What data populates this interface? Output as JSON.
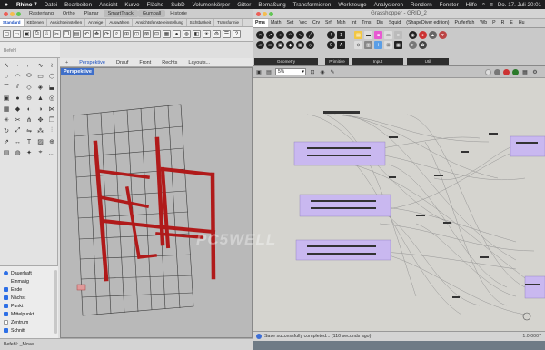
{
  "menubar": {
    "app": "Rhino 7",
    "items": [
      "Datei",
      "Bearbeiten",
      "Ansicht",
      "Kurve",
      "Fläche",
      "SubD",
      "Volumenkörper",
      "Gitter",
      "Bemaßung",
      "Transformieren",
      "Werkzeuge",
      "Analysieren",
      "Rendern",
      "Fenster",
      "Hilfe"
    ],
    "clock": "Do. 17. Juli 20:01"
  },
  "rhino": {
    "top_tabs": [
      "Rasterfang",
      "Ortho",
      "Planar",
      "SmartTrack",
      "Gumball",
      "Historie"
    ],
    "toolbar_tabs": [
      "Standard",
      "KEbenen",
      "Ansicht einstellen",
      "Anzeige",
      "Auswählen",
      "Ansichtsfenstereinstellung",
      "Sichtbarkeit",
      "Transformie"
    ],
    "command_placeholder": "Befehl",
    "viewport_tabs": [
      "Perspektive",
      "Drauf",
      "Front",
      "Rechts",
      "Layouts..."
    ],
    "viewport_label": "Perspektive",
    "osnap": [
      {
        "label": "Dauerhaft",
        "checked": true,
        "type": "radio"
      },
      {
        "label": "Einmalig",
        "checked": false,
        "type": "radio-hidden"
      },
      {
        "label": "Ende",
        "checked": true,
        "type": "check"
      },
      {
        "label": "Nächst",
        "checked": true,
        "type": "check"
      },
      {
        "label": "Punkt",
        "checked": true,
        "type": "check"
      },
      {
        "label": "Mittelpunkt",
        "checked": true,
        "type": "check"
      },
      {
        "label": "Zentrum",
        "checked": false,
        "type": "check"
      },
      {
        "label": "Schnitt",
        "checked": true,
        "type": "check"
      }
    ],
    "status": "Befehl: _Move"
  },
  "grasshopper": {
    "title": "Grasshopper - GRID_2",
    "tabs": [
      "Pms",
      "Math",
      "Set",
      "Vec",
      "Crv",
      "Srf",
      "Msh",
      "Int",
      "Trns",
      "Dis",
      "Squid",
      "(ShapeDiver edition)",
      "Pufferfish",
      "Wb",
      "P",
      "R",
      "E",
      "Hu"
    ],
    "groups": [
      "Geometry",
      "Primitive",
      "Input",
      "Util"
    ],
    "zoom": "5%",
    "status_message": "Save successfully completed... (110 seconds ago)",
    "version": "1.0.0007"
  },
  "colors": {
    "chair_red": "#b01a1a",
    "node_purple": "#c9b8f0",
    "accent_blue": "#2d6fe6"
  },
  "watermark": "PC5WELL"
}
